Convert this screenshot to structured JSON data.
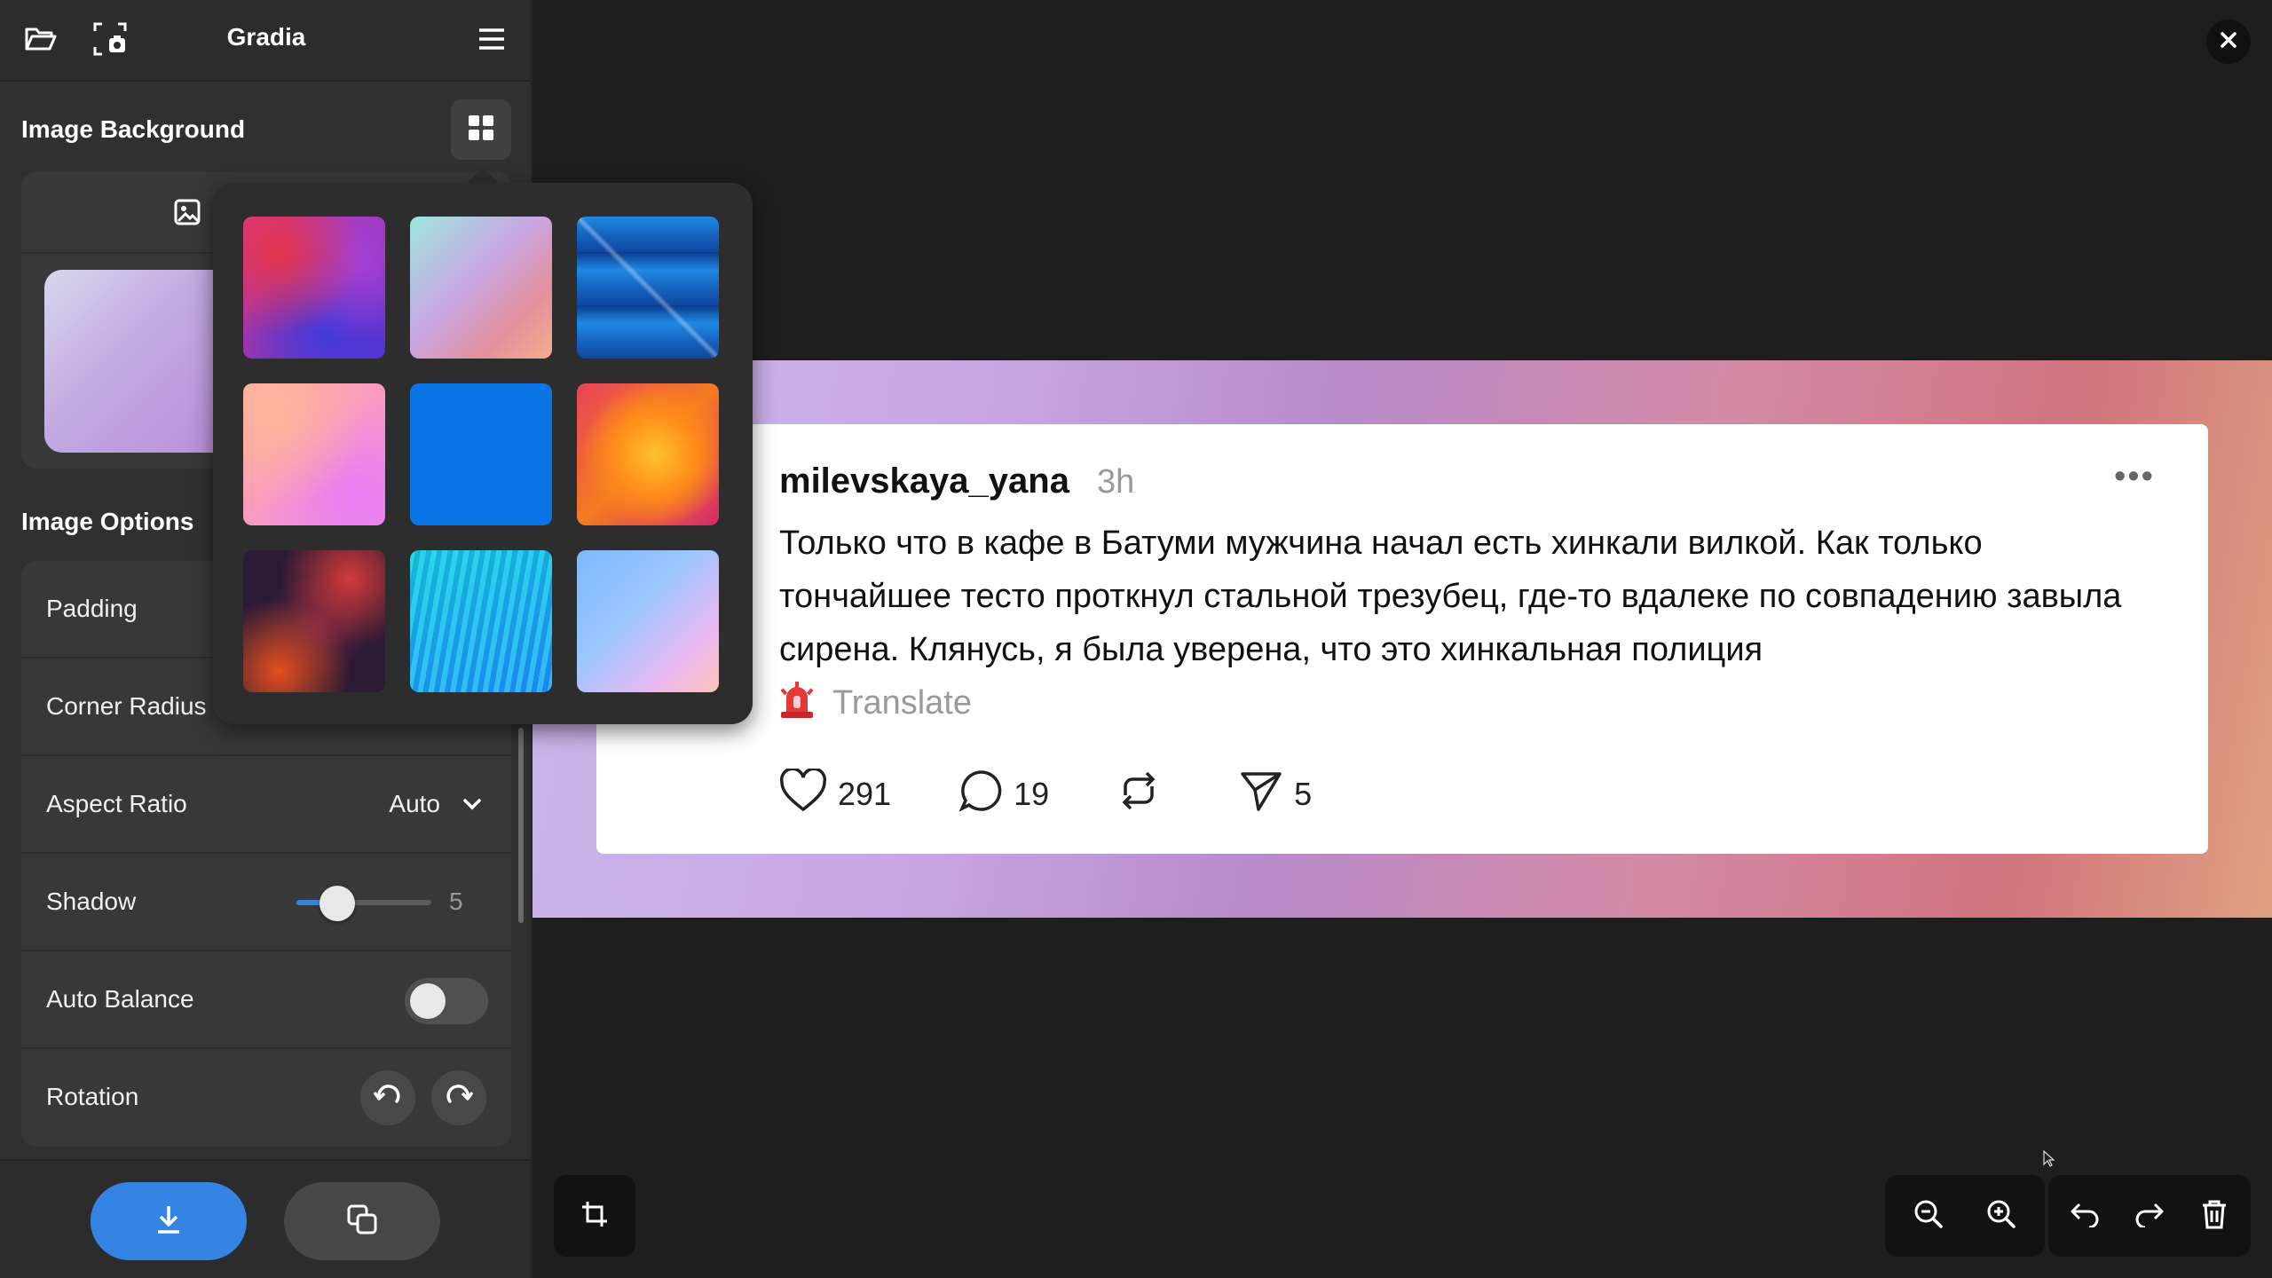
{
  "app": {
    "title": "Gradia"
  },
  "header": {
    "open_icon": "folder-open-icon",
    "screenshot_icon": "screenshot-icon",
    "menu_icon": "hamburger-menu-icon"
  },
  "background_section": {
    "title": "Image Background",
    "grid_icon": "grid-icon",
    "image_tab_icon": "image-icon",
    "presets": [
      {
        "name": "magenta-blue-red"
      },
      {
        "name": "mint-lilac-peach"
      },
      {
        "name": "blue-geometric"
      },
      {
        "name": "peach-pink"
      },
      {
        "name": "solid-blue"
      },
      {
        "name": "orange-fire"
      },
      {
        "name": "dark-red-waves"
      },
      {
        "name": "teal-blue-waves"
      },
      {
        "name": "pastel-blue-pink"
      }
    ]
  },
  "options_section": {
    "title": "Image Options",
    "padding_label": "Padding",
    "corner_radius_label": "Corner Radius",
    "aspect_ratio_label": "Aspect Ratio",
    "aspect_ratio_value": "Auto",
    "shadow_label": "Shadow",
    "shadow_value": "5",
    "shadow_level": 0.3,
    "auto_balance_label": "Auto Balance",
    "auto_balance_on": false,
    "rotation_label": "Rotation"
  },
  "footer": {
    "save_icon": "download-icon",
    "copy_icon": "copy-icon"
  },
  "post": {
    "username": "milevskaya_yana",
    "time": "3h",
    "more": "•••",
    "text": "Только что в кафе в Батуми мужчина начал есть хинкали вилкой. Как только тончайшее тесто проткнул стальной трезубец, где-то вдалеке по совпадению завыла сирена. Клянусь, я была уверена, что это хинкальная полиция",
    "translate": "Translate",
    "likes": "291",
    "comments": "19",
    "shares": "5"
  },
  "toolbar": {
    "crop_icon": "crop-icon",
    "zoom_out_icon": "zoom-out-icon",
    "zoom_in_icon": "zoom-in-icon",
    "undo_icon": "undo-icon",
    "redo_icon": "redo-icon",
    "delete_icon": "trash-icon",
    "close_icon": "close-icon"
  },
  "colors": {
    "accent": "#3584e4",
    "sidebar_bg": "#303030",
    "canvas_bg": "#1e1e1e"
  }
}
